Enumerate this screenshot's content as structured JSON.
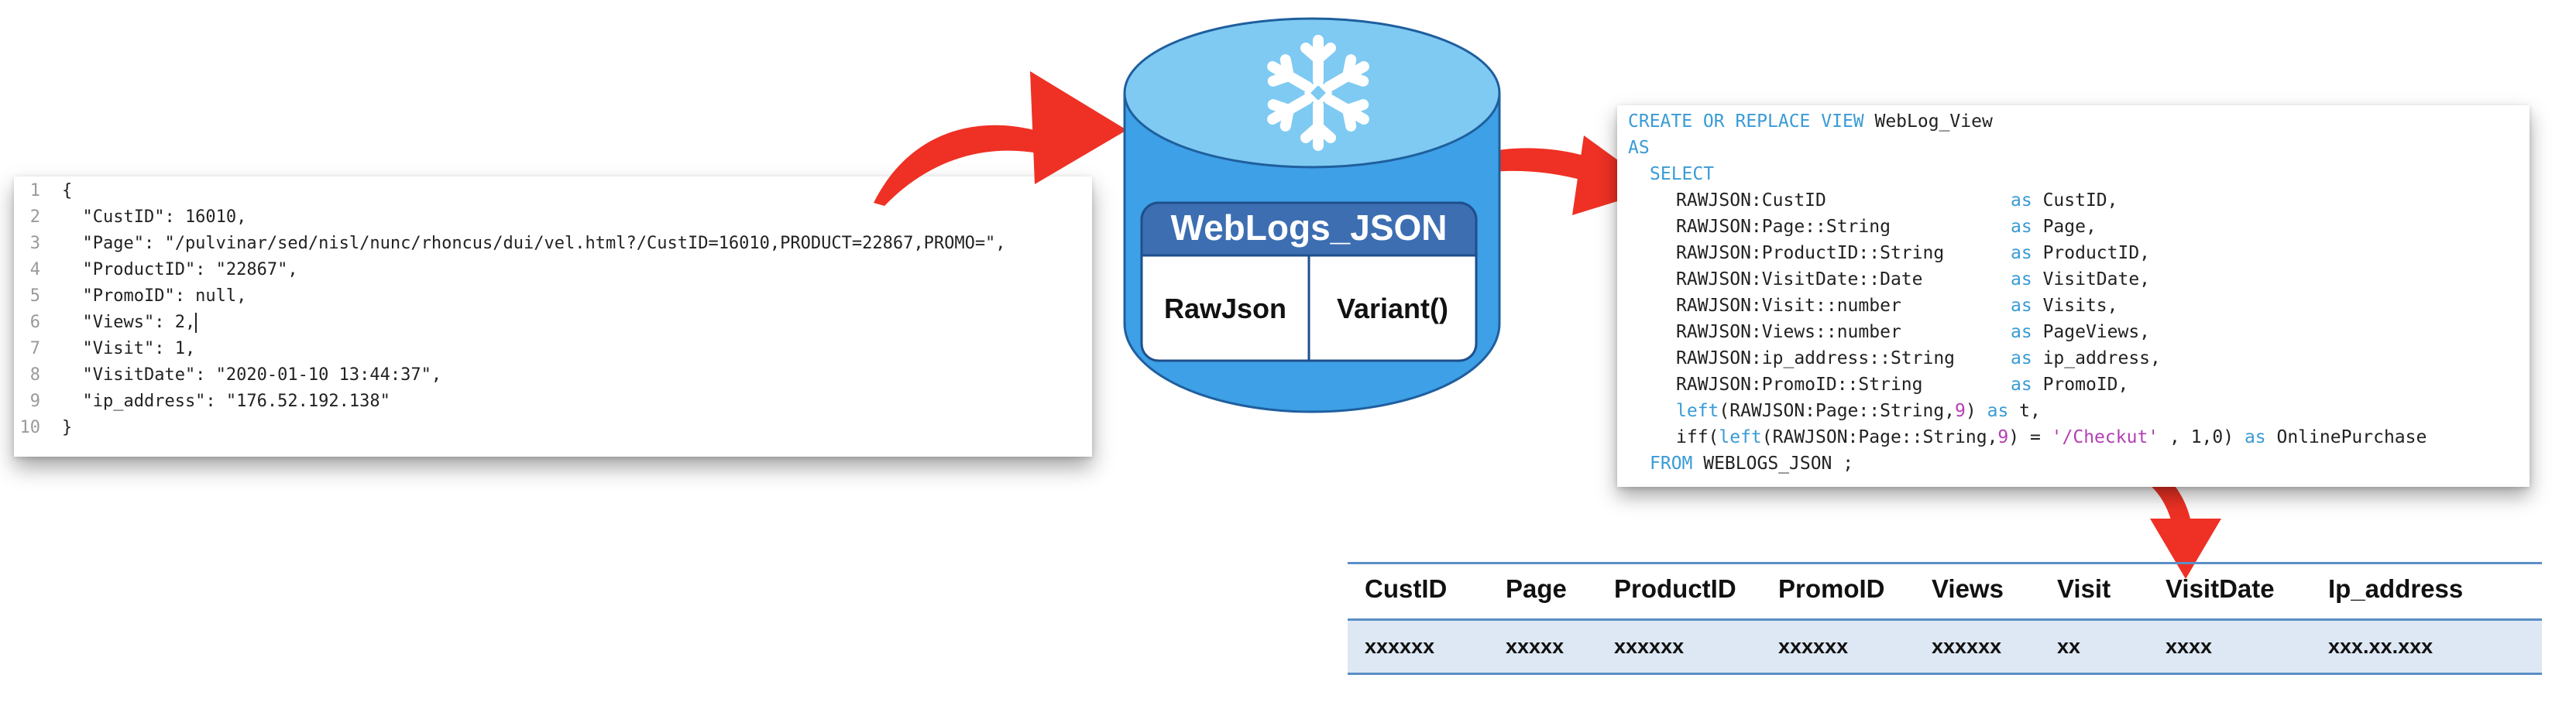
{
  "json_panel": {
    "lines": [
      {
        "n": "1",
        "text": "{"
      },
      {
        "n": "2",
        "text": "  \"CustID\": 16010,"
      },
      {
        "n": "3",
        "text": "  \"Page\": \"/pulvinar/sed/nisl/nunc/rhoncus/dui/vel.html?/CustID=16010,PRODUCT=22867,PROMO=\","
      },
      {
        "n": "4",
        "text": "  \"ProductID\": \"22867\","
      },
      {
        "n": "5",
        "text": "  \"PromoID\": null,"
      },
      {
        "n": "6",
        "text": "  \"Views\": 2,"
      },
      {
        "n": "7",
        "text": "  \"Visit\": 1,"
      },
      {
        "n": "8",
        "text": "  \"VisitDate\": \"2020-01-10 13:44:37\","
      },
      {
        "n": "9",
        "text": "  \"ip_address\": \"176.52.192.138\""
      },
      {
        "n": "10",
        "text": "}"
      }
    ]
  },
  "database": {
    "icon": "snowflake-icon",
    "title": "WebLogs_JSON",
    "columns": [
      "RawJson",
      "Variant()"
    ],
    "colors": {
      "cylinder": "#3ea0e6",
      "cylinder_top": "#7fcaf2",
      "header": "#3d6eb2"
    }
  },
  "sql": {
    "line1_kw": "CREATE OR REPLACE VIEW",
    "line1_name": " WebLog_View",
    "line2_kw": "AS",
    "line3_kw": "SELECT",
    "fields": [
      {
        "expr": "RAWJSON:CustID",
        "alias": "CustID,"
      },
      {
        "expr": "RAWJSON:Page::String",
        "alias": "Page,"
      },
      {
        "expr": "RAWJSON:ProductID::String",
        "alias": "ProductID,"
      },
      {
        "expr": "RAWJSON:VisitDate::Date",
        "alias": "VisitDate,"
      },
      {
        "expr": "RAWJSON:Visit::number",
        "alias": "Visits,"
      },
      {
        "expr": "RAWJSON:Views::number",
        "alias": "PageViews,"
      },
      {
        "expr": "RAWJSON:ip_address::String",
        "alias": "ip_address,"
      },
      {
        "expr": "RAWJSON:PromoID::String",
        "alias": "PromoID,"
      }
    ],
    "as_kw": "as",
    "left_line": {
      "fn": "left",
      "args": "(RAWJSON:Page::String,",
      "num": "9",
      "close": ")",
      "as": "as",
      "alias": " t,"
    },
    "iff_line": {
      "fn": "iff(",
      "left": "left",
      "args": "(RAWJSON:Page::String,",
      "num": "9",
      "mid": ") = ",
      "str": "'/Checkut'",
      "tail": " , 1,0) ",
      "as": "as",
      "alias": " OnlinePurchase"
    },
    "from_kw": "FROM",
    "from_rest": " WEBLOGS_JSON ;"
  },
  "result_table": {
    "headers": [
      "CustID",
      "Page",
      "ProductID",
      "PromoID",
      "Views",
      "Visit",
      "VisitDate",
      "Ip_address"
    ],
    "row": [
      "xxxxxx",
      "xxxxx",
      "xxxxxx",
      "xxxxxx",
      "xxxxxx",
      "xx",
      "xxxx",
      "xxx.xx.xxx"
    ],
    "colors": {
      "rule": "#5b8fc7",
      "row_bg": "#dde8f4"
    }
  },
  "arrows": {
    "color": "#ee3124"
  }
}
